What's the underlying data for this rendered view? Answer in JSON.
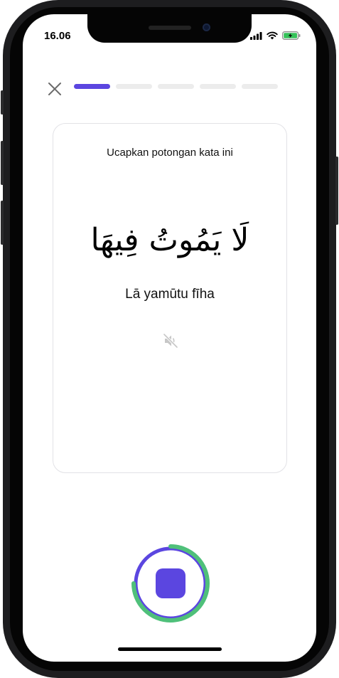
{
  "status_bar": {
    "time": "16.06",
    "icons": [
      "signal-icon",
      "wifi-icon",
      "battery-charging-icon"
    ]
  },
  "header": {
    "close_icon": "close-icon",
    "progress": {
      "total_steps": 5,
      "current_step": 1,
      "accent": "#5b46e0"
    }
  },
  "card": {
    "instruction": "Ucapkan potongan kata ini",
    "arabic_text": "لَا يَمُوتُ فِيهَا",
    "transliteration": "Lā yamūtu fīha",
    "audio_icon": "speaker-muted-icon"
  },
  "record": {
    "state": "recording",
    "icon": "stop-icon",
    "ring_progress": 0.75,
    "colors": {
      "ring": "#5b46e0",
      "progress": "#4fc07a",
      "button": "#5b46e0"
    }
  }
}
